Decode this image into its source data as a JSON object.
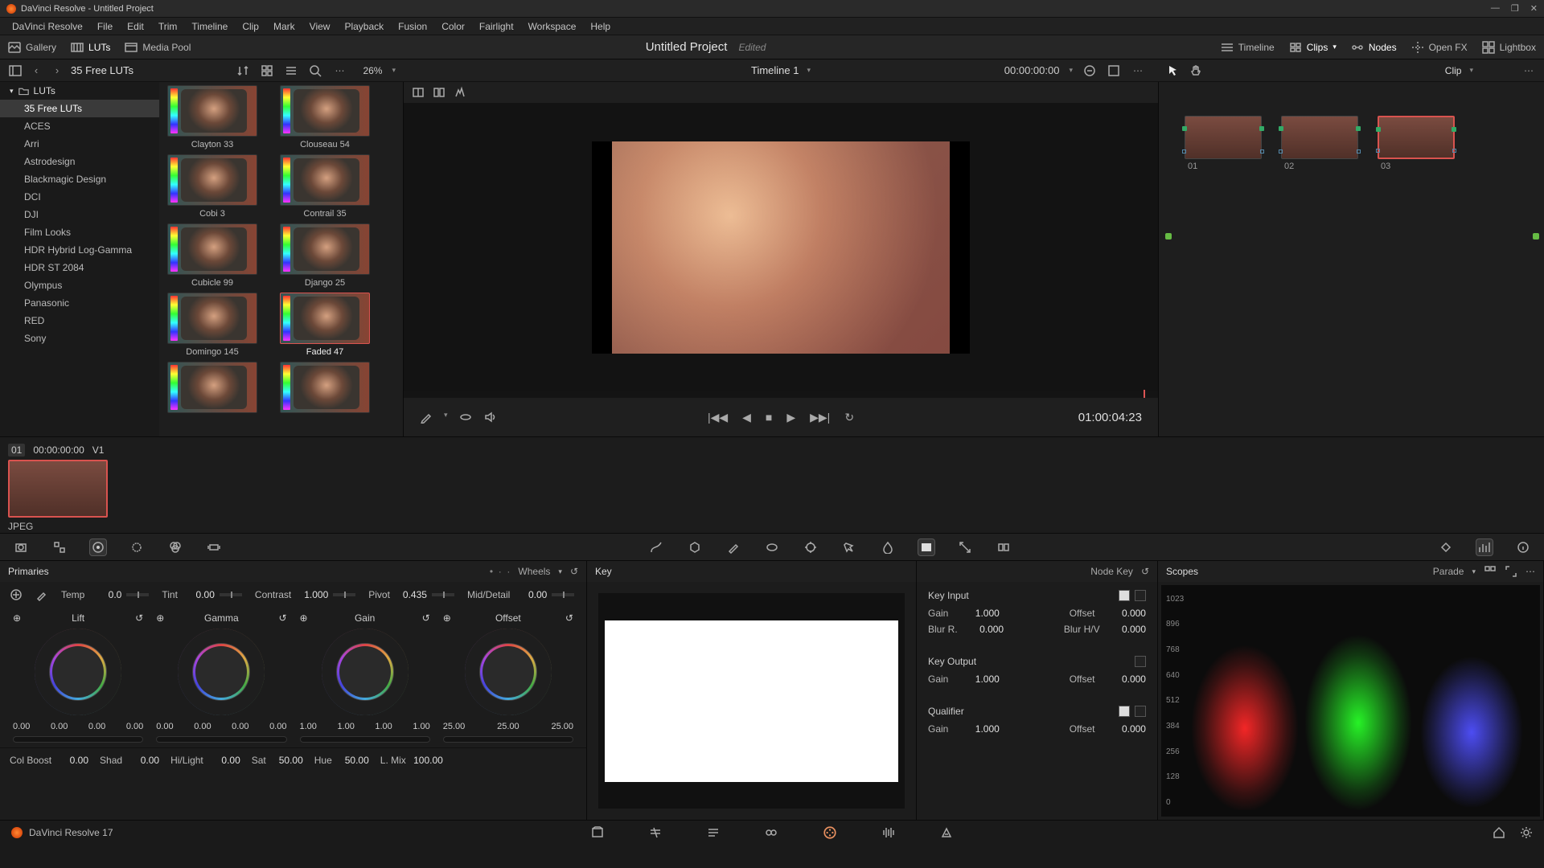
{
  "app": {
    "title": "DaVinci Resolve - Untitled Project",
    "version_label": "DaVinci Resolve 17"
  },
  "window_controls": {
    "min": "—",
    "max": "❐",
    "close": "✕"
  },
  "menu": [
    "DaVinci Resolve",
    "File",
    "Edit",
    "Trim",
    "Timeline",
    "Clip",
    "Mark",
    "View",
    "Playback",
    "Fusion",
    "Color",
    "Fairlight",
    "Workspace",
    "Help"
  ],
  "toolbar": {
    "left": {
      "gallery": "Gallery",
      "luts": "LUTs",
      "media_pool": "Media Pool"
    },
    "project": {
      "name": "Untitled Project",
      "status": "Edited"
    },
    "right": {
      "timeline": "Timeline",
      "clips": "Clips",
      "nodes": "Nodes",
      "openfx": "Open FX",
      "lightbox": "Lightbox"
    }
  },
  "subtool": {
    "lut_category": "35 Free LUTs",
    "zoom": "26%",
    "timeline_name": "Timeline 1",
    "source_tc": "00:00:00:00",
    "node_mode": "Clip"
  },
  "lut_tree": {
    "root": "LUTs",
    "items": [
      "35 Free LUTs",
      "ACES",
      "Arri",
      "Astrodesign",
      "Blackmagic Design",
      "DCI",
      "DJI",
      "Film Looks",
      "HDR Hybrid Log-Gamma",
      "HDR ST 2084",
      "Olympus",
      "Panasonic",
      "RED",
      "Sony"
    ],
    "active": "35 Free LUTs"
  },
  "lut_grid": [
    {
      "label": "Clayton 33"
    },
    {
      "label": "Clouseau 54"
    },
    {
      "label": "Cobi 3"
    },
    {
      "label": "Contrail 35"
    },
    {
      "label": "Cubicle 99"
    },
    {
      "label": "Django 25"
    },
    {
      "label": "Domingo 145"
    },
    {
      "label": "Faded 47",
      "selected": true
    },
    {
      "label": ""
    },
    {
      "label": ""
    }
  ],
  "viewer": {
    "record_tc": "01:00:04:23"
  },
  "nodes": [
    {
      "id": "01"
    },
    {
      "id": "02"
    },
    {
      "id": "03",
      "selected": true
    }
  ],
  "clipstrip": {
    "num": "01",
    "tc": "00:00:00:00",
    "track": "V1",
    "format": "JPEG"
  },
  "primaries": {
    "title": "Primaries",
    "mode": "Wheels",
    "top_adj": [
      {
        "name": "Temp",
        "value": "0.0"
      },
      {
        "name": "Tint",
        "value": "0.00"
      },
      {
        "name": "Contrast",
        "value": "1.000"
      },
      {
        "name": "Pivot",
        "value": "0.435"
      },
      {
        "name": "Mid/Detail",
        "value": "0.00"
      }
    ],
    "wheels": [
      {
        "name": "Lift",
        "nums": [
          "0.00",
          "0.00",
          "0.00",
          "0.00"
        ]
      },
      {
        "name": "Gamma",
        "nums": [
          "0.00",
          "0.00",
          "0.00",
          "0.00"
        ]
      },
      {
        "name": "Gain",
        "nums": [
          "1.00",
          "1.00",
          "1.00",
          "1.00"
        ]
      },
      {
        "name": "Offset",
        "nums": [
          "25.00",
          "25.00",
          "25.00"
        ]
      }
    ],
    "bot_adj": [
      {
        "name": "Col Boost",
        "value": "0.00"
      },
      {
        "name": "Shad",
        "value": "0.00"
      },
      {
        "name": "Hi/Light",
        "value": "0.00"
      },
      {
        "name": "Sat",
        "value": "50.00"
      },
      {
        "name": "Hue",
        "value": "50.00"
      },
      {
        "name": "L. Mix",
        "value": "100.00"
      }
    ]
  },
  "key_panel": {
    "title": "Key"
  },
  "node_key": {
    "title": "Node Key",
    "sections": [
      {
        "name": "Key Input",
        "params": [
          {
            "n": "Gain",
            "v": "1.000"
          },
          {
            "n": "Offset",
            "v": "0.000"
          },
          {
            "n": "Blur R.",
            "v": "0.000"
          },
          {
            "n": "Blur H/V",
            "v": "0.000"
          }
        ]
      },
      {
        "name": "Key Output",
        "params": [
          {
            "n": "Gain",
            "v": "1.000"
          },
          {
            "n": "Offset",
            "v": "0.000"
          }
        ]
      },
      {
        "name": "Qualifier",
        "params": [
          {
            "n": "Gain",
            "v": "1.000"
          },
          {
            "n": "Offset",
            "v": "0.000"
          }
        ]
      }
    ]
  },
  "scopes": {
    "title": "Scopes",
    "mode": "Parade",
    "ylabels": [
      "1023",
      "896",
      "768",
      "640",
      "512",
      "384",
      "256",
      "128",
      "0"
    ]
  },
  "pages": [
    "media",
    "cut",
    "edit",
    "fusion",
    "color",
    "fairlight",
    "deliver"
  ]
}
